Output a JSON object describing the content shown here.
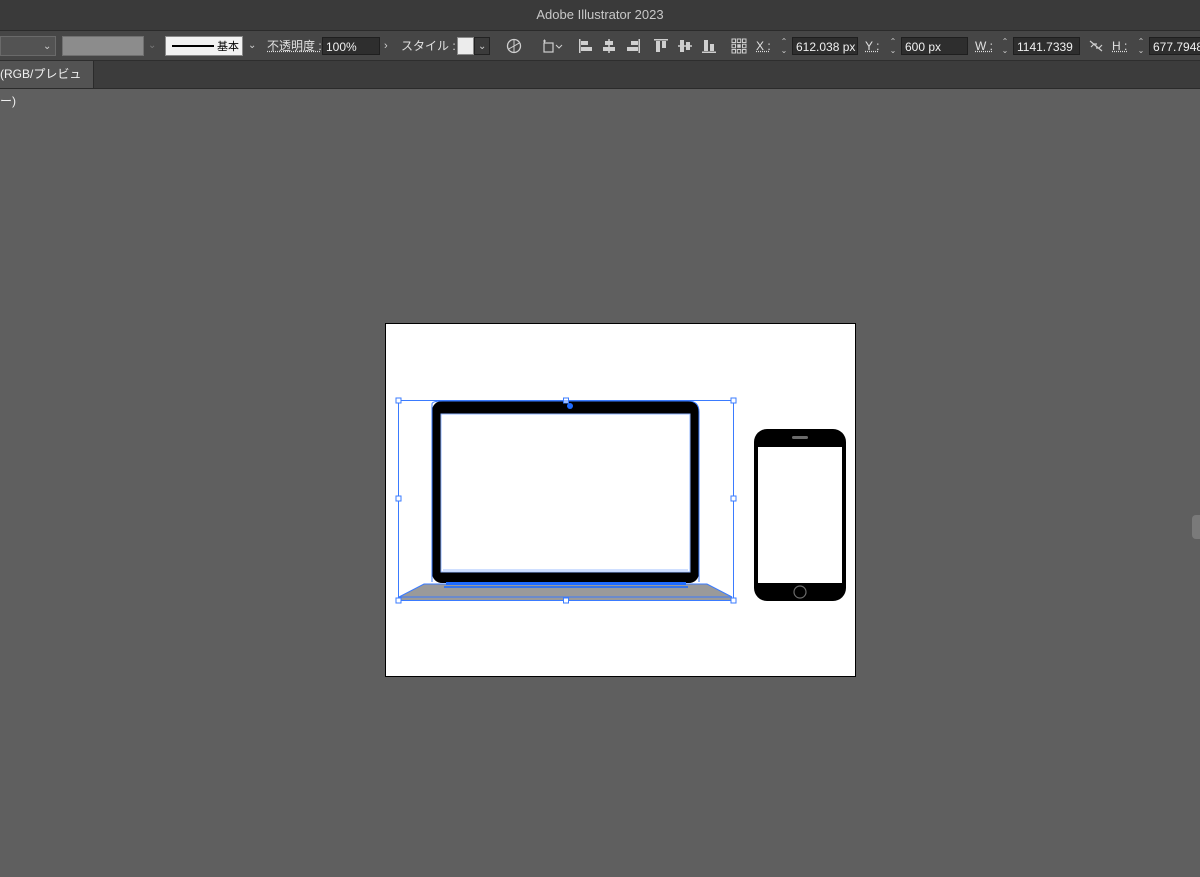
{
  "app": {
    "title": "Adobe Illustrator 2023"
  },
  "control_bar": {
    "stroke_profile_label": "基本",
    "opacity_label": "不透明度 :",
    "opacity_value": "100%",
    "style_label": "スタイル :",
    "x_label": "X :",
    "x_value": "612.038 px",
    "y_label": "Y :",
    "y_value": "600 px",
    "w_label": "W :",
    "w_value": "1141.7339",
    "h_label": "H :",
    "h_value": "677.7948"
  },
  "document_tab": {
    "label": "(RGB/プレビュー)"
  },
  "colors": {
    "selection": "#3a7bff",
    "artboard": "#ffffff",
    "canvas": "#5f5f5f",
    "device": "#000000"
  }
}
